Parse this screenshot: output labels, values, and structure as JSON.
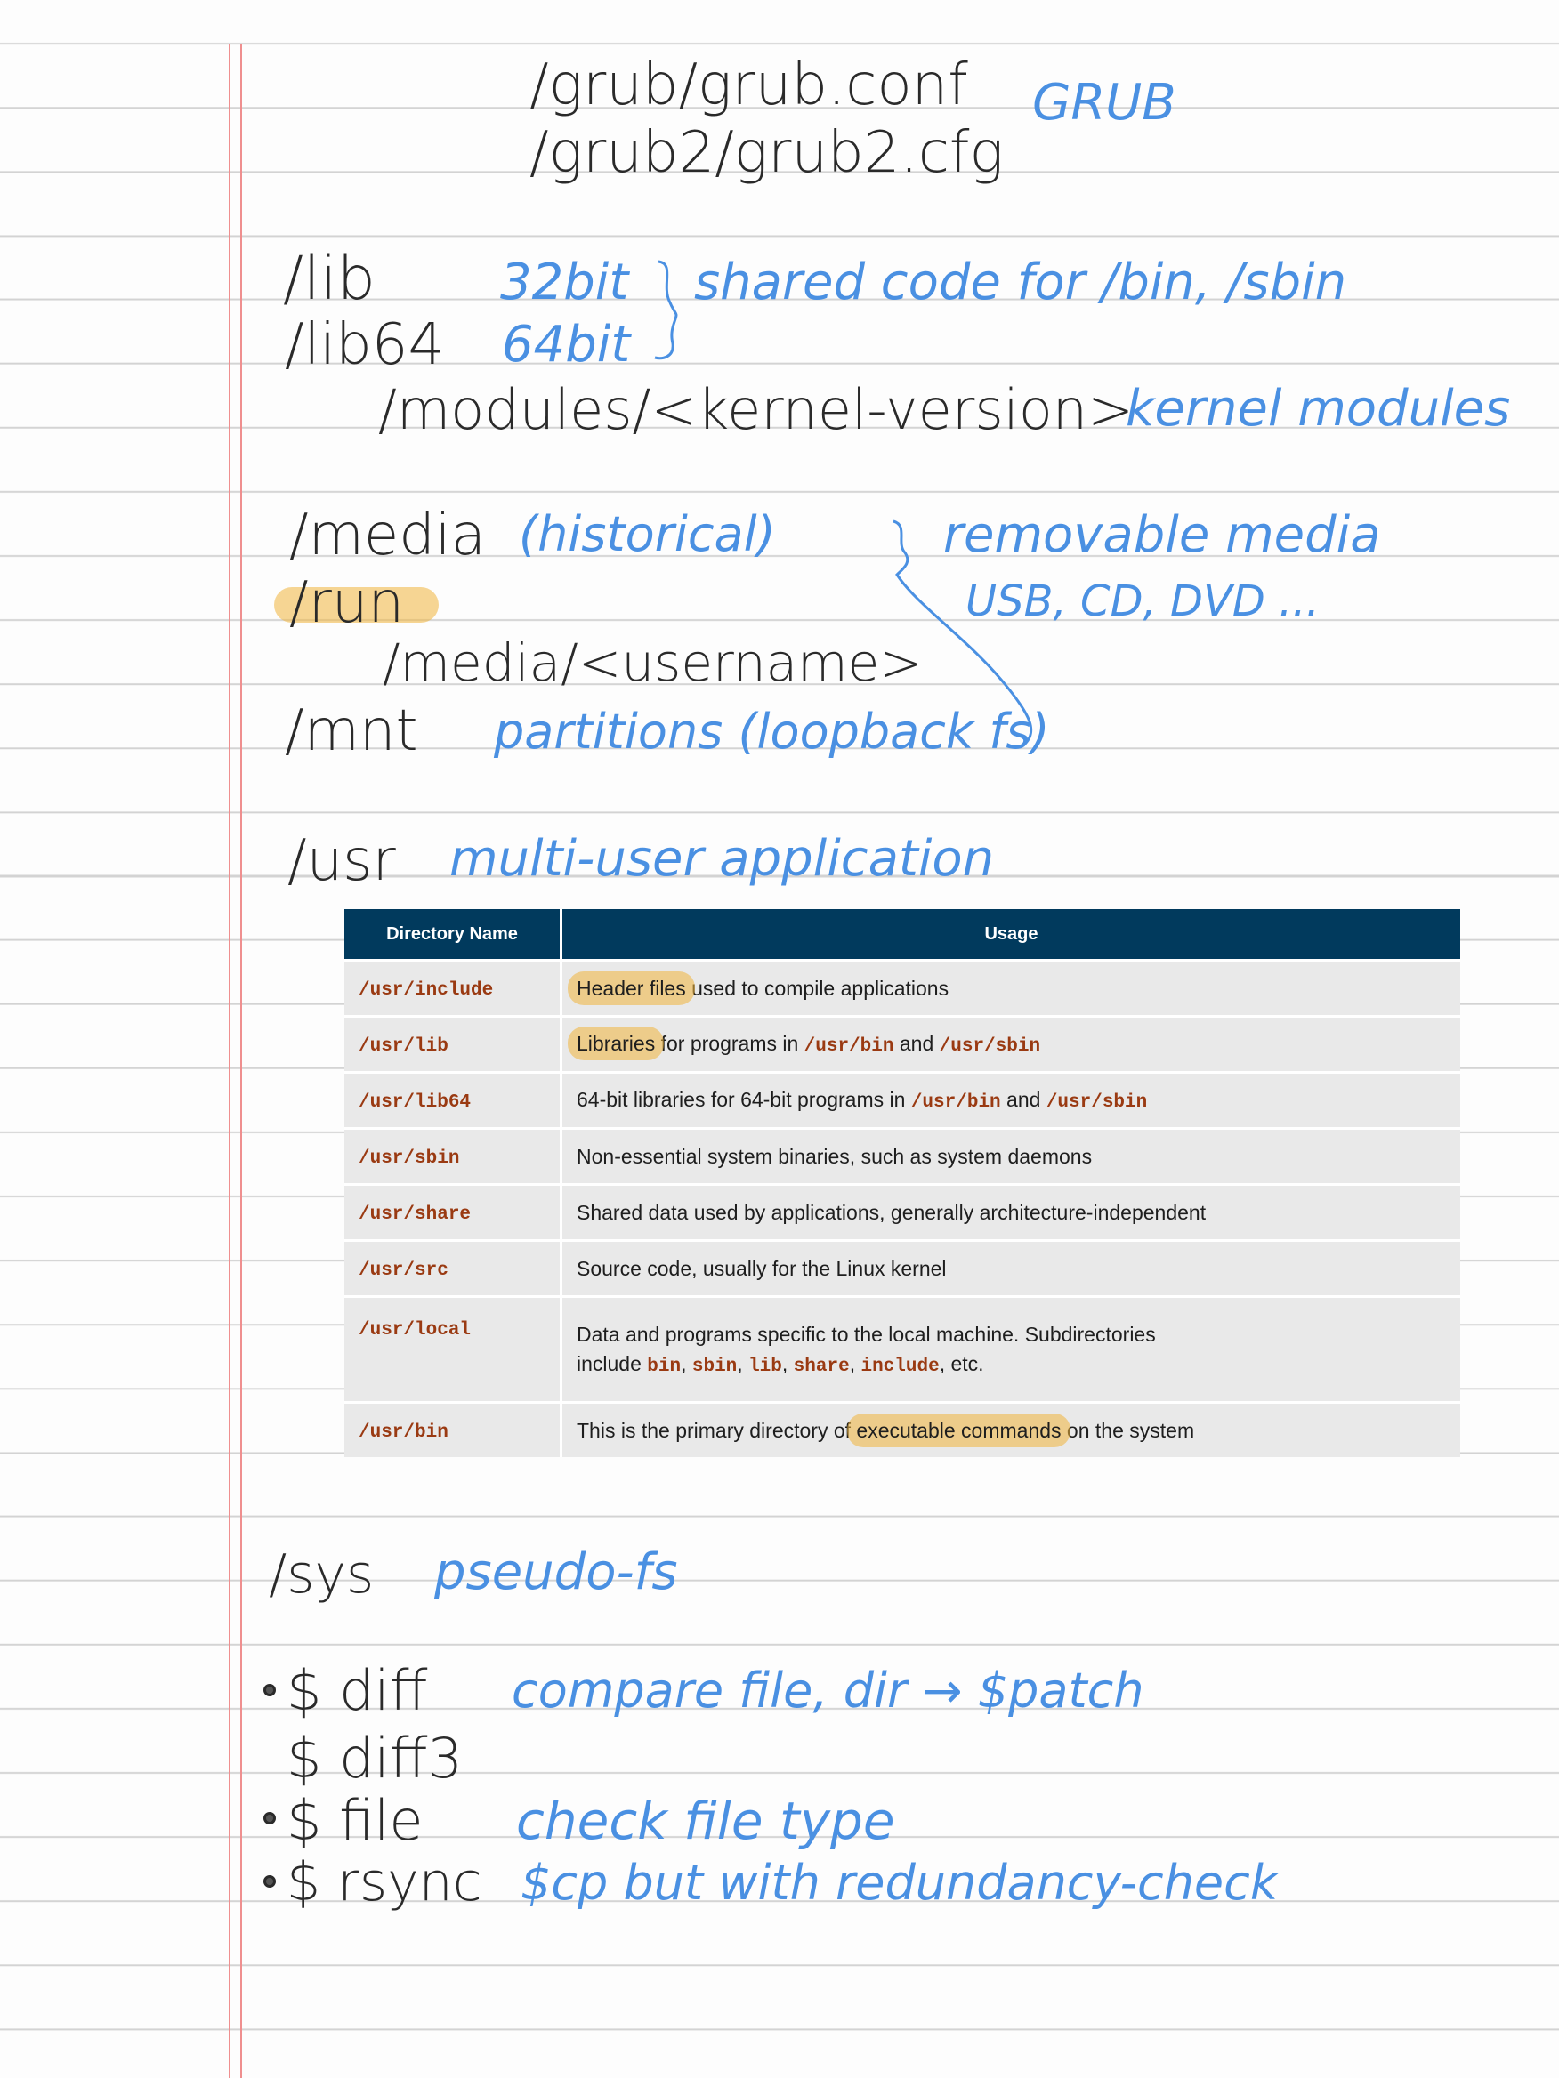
{
  "grub": {
    "path1": "/grub/grub.conf",
    "path2": "/grub2/grub2.cfg",
    "note": "GRUB"
  },
  "lib": {
    "lib": "/lib",
    "lib_note": "32bit",
    "lib64": "/lib64",
    "lib64_note": "64bit",
    "shared_note": "shared code for /bin, /sbin",
    "modules": "/modules/<kernel-version>",
    "modules_note": "kernel modules"
  },
  "media": {
    "media": "/media",
    "media_note": "(historical)",
    "run": "/run",
    "run_media": "/media/<username>",
    "mnt": "/mnt",
    "mnt_note": "partitions (loopback fs)",
    "removable_1": "removable media",
    "removable_2": "USB, CD, DVD ..."
  },
  "usr": {
    "heading": "/usr",
    "heading_note": "multi-user application"
  },
  "table": {
    "col1": "Directory Name",
    "col2": "Usage",
    "rows": [
      {
        "dir": "/usr/include",
        "hl": "Header files",
        "rest": " used to compile applications"
      },
      {
        "dir": "/usr/lib",
        "hl": "Libraries",
        "rest": " for programs in ",
        "c1": "/usr/bin",
        "and": " and ",
        "c2": "/usr/sbin"
      },
      {
        "dir": "/usr/lib64",
        "pre": "64-bit libraries for 64-bit programs in ",
        "c1": "/usr/bin",
        "and": " and ",
        "c2": "/usr/sbin"
      },
      {
        "dir": "/usr/sbin",
        "text": "Non-essential system binaries, such as system daemons"
      },
      {
        "dir": "/usr/share",
        "text": "Shared data used by applications, generally architecture-independent"
      },
      {
        "dir": "/usr/src",
        "text": "Source code, usually for the Linux kernel"
      },
      {
        "dir": "/usr/local",
        "line1": "Data and programs specific to the local machine. Subdirectories",
        "line2_pre": "include ",
        "codes": [
          "bin",
          "sbin",
          "lib",
          "share",
          "include"
        ],
        "sep": ", ",
        "line2_post": ", etc."
      },
      {
        "dir": "/usr/bin",
        "pre": "This is the primary directory of ",
        "hl": "executable commands",
        "post": " on the system"
      }
    ]
  },
  "sys": {
    "heading": "/sys",
    "note": "pseudo-fs"
  },
  "commands": [
    {
      "cmd": "$ diff",
      "note": "compare file, dir → $patch",
      "bullet": true
    },
    {
      "cmd": "$ diff3",
      "note": "",
      "bullet": false
    },
    {
      "cmd": "$ file",
      "note": "check file type",
      "bullet": true
    },
    {
      "cmd": "$ rsync",
      "note": "$cp but with redundancy-check",
      "bullet": true
    }
  ],
  "colors": {
    "ink": "#2a2a2a",
    "blue_ink": "#4a90e2",
    "highlight": "#f0b43c",
    "margin": "#ef8f8f",
    "table_header": "#013a5d",
    "code": "#9a3a12"
  }
}
